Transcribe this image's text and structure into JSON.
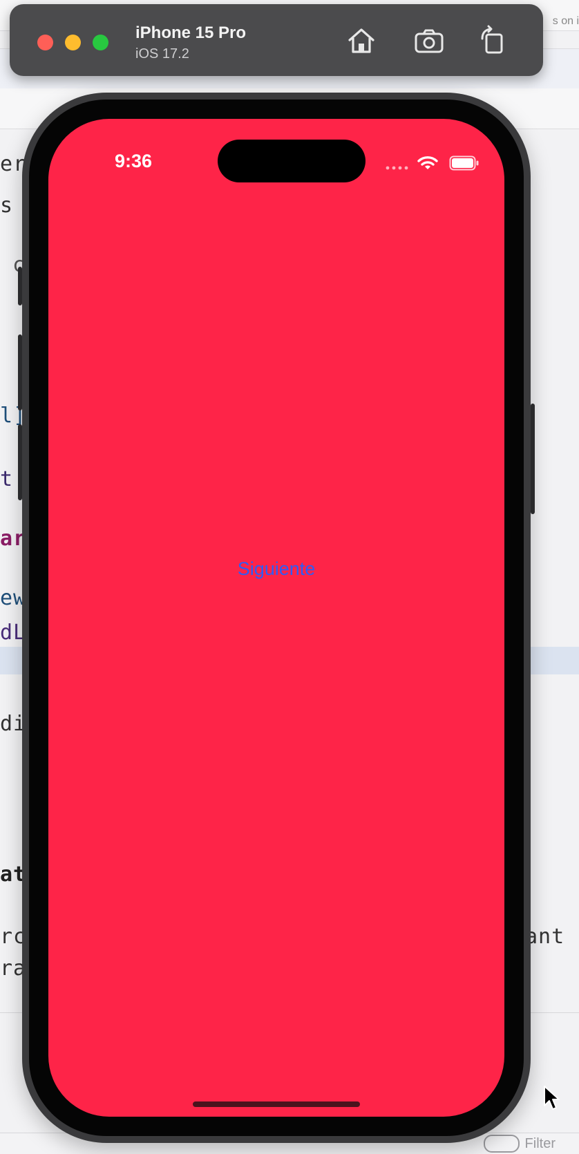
{
  "simulator": {
    "device_name": "iPhone 15 Pro",
    "os_version": "iOS 17.2",
    "toolbar": [
      {
        "name": "home",
        "icon": "home-icon"
      },
      {
        "name": "screenshot",
        "icon": "camera-icon"
      },
      {
        "name": "rotate",
        "icon": "rotate-icon"
      }
    ]
  },
  "status_bar": {
    "time": "9:36"
  },
  "app": {
    "background_color": "#fe2448",
    "next_button_label": "Siguiente",
    "accent_color": "#2f5cf5"
  },
  "background_editor": {
    "tooltip_fragment": "s on i",
    "filter_label": "Filter",
    "code_fragments": [
      "er",
      "s",
      "c",
      "l]",
      "t:",
      "ar",
      "ew",
      "dL",
      "di",
      "at",
      "rc",
      "ra",
      "ant f"
    ]
  }
}
